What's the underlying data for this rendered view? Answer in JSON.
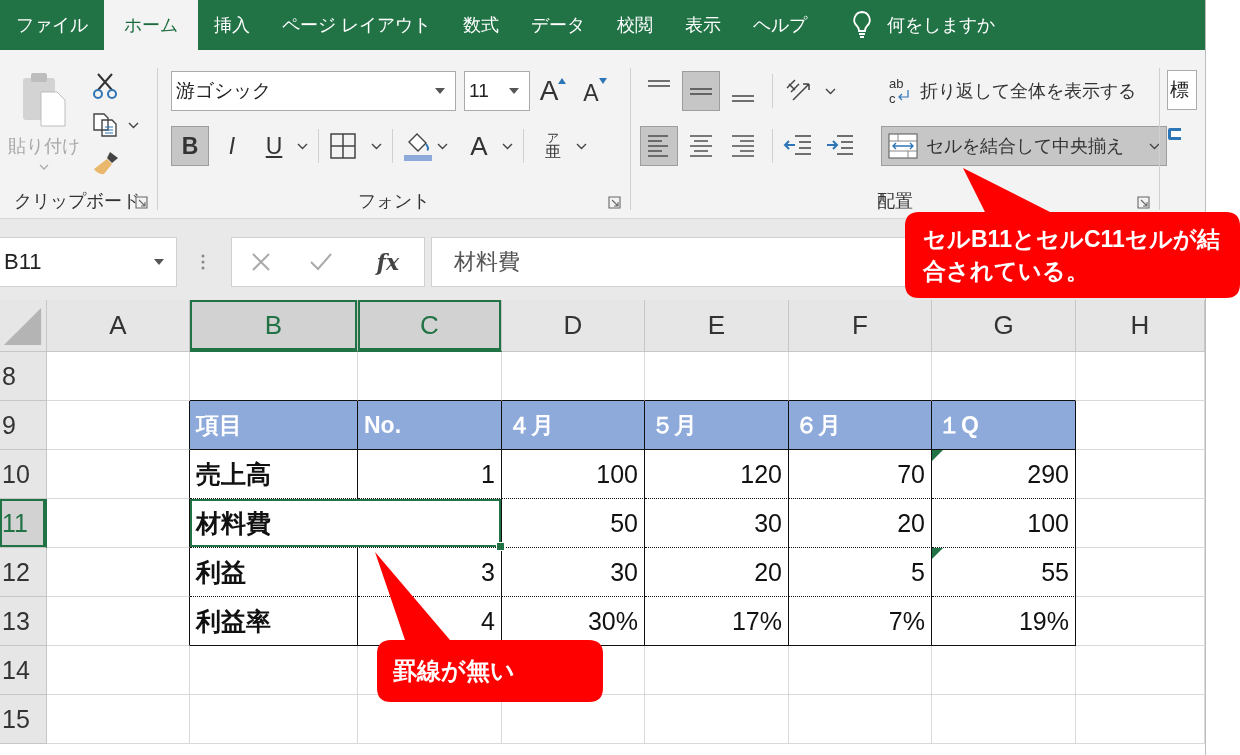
{
  "menu": {
    "tabs": [
      {
        "label": "ファイル",
        "selected": false
      },
      {
        "label": "ホーム",
        "selected": true
      },
      {
        "label": "挿入",
        "selected": false
      },
      {
        "label": "ページ レイアウト",
        "selected": false
      },
      {
        "label": "数式",
        "selected": false
      },
      {
        "label": "データ",
        "selected": false
      },
      {
        "label": "校閲",
        "selected": false
      },
      {
        "label": "表示",
        "selected": false
      },
      {
        "label": "ヘルプ",
        "selected": false
      }
    ],
    "tell_me": "何をしますか"
  },
  "ribbon": {
    "clipboard": {
      "paste": "貼り付け",
      "label": "クリップボード"
    },
    "font": {
      "name": "游ゴシック",
      "size": "11",
      "grow": "A",
      "shrink": "A",
      "styles": [
        {
          "kind": "bold",
          "label": "B",
          "pressed": true
        },
        {
          "kind": "italic",
          "label": "I",
          "pressed": false
        },
        {
          "kind": "underline",
          "label": "U",
          "pressed": false
        }
      ],
      "font_color": "A",
      "phonetic_top": "ア",
      "phonetic_bottom": "亜",
      "label": "フォント"
    },
    "alignment": {
      "vertical": [
        {
          "kind": "top",
          "pressed": false
        },
        {
          "kind": "middle",
          "pressed": true
        },
        {
          "kind": "bottom",
          "pressed": false
        }
      ],
      "horizontal": [
        {
          "kind": "left",
          "pressed": true
        },
        {
          "kind": "center",
          "pressed": false
        },
        {
          "kind": "right",
          "pressed": false
        }
      ],
      "wrap_glyph_top": "ab",
      "wrap_glyph_bottom": "c",
      "wrap_text": "折り返して全体を表示する",
      "merge": {
        "label": "セルを結合して中央揃え",
        "pressed": true
      },
      "label": "配置"
    },
    "styles": {
      "box": "標"
    }
  },
  "formula_bar": {
    "name_box": "B11",
    "fx": "fx",
    "value": "材料費"
  },
  "sheet": {
    "columns": [
      {
        "label": "A",
        "selected": false
      },
      {
        "label": "B",
        "selected": true
      },
      {
        "label": "C",
        "selected": true
      },
      {
        "label": "D",
        "selected": false
      },
      {
        "label": "E",
        "selected": false
      },
      {
        "label": "F",
        "selected": false
      },
      {
        "label": "G",
        "selected": false
      },
      {
        "label": "H",
        "selected": false
      }
    ],
    "rows": [
      {
        "label": "8",
        "selected": false,
        "kind": "empty"
      },
      {
        "label": "9",
        "selected": false,
        "kind": "header",
        "cells": [
          {
            "text": "項目",
            "merged": false,
            "selected": false,
            "error_indicator": false
          },
          {
            "text": "No.",
            "merged": false,
            "selected": false,
            "error_indicator": false
          },
          {
            "text": "４月",
            "merged": false,
            "selected": false,
            "error_indicator": false
          },
          {
            "text": "５月",
            "merged": false,
            "selected": false,
            "error_indicator": false
          },
          {
            "text": "６月",
            "merged": false,
            "selected": false,
            "error_indicator": false
          },
          {
            "text": "１Q",
            "merged": false,
            "selected": false,
            "error_indicator": false
          }
        ]
      },
      {
        "label": "10",
        "selected": false,
        "kind": "data",
        "cells": [
          {
            "text": "売上高",
            "merged": false,
            "selected": false,
            "error_indicator": false
          },
          {
            "text": "1",
            "merged": false,
            "selected": false,
            "error_indicator": false
          },
          {
            "text": "100",
            "merged": false,
            "selected": false,
            "error_indicator": false
          },
          {
            "text": "120",
            "merged": false,
            "selected": false,
            "error_indicator": false
          },
          {
            "text": "70",
            "merged": false,
            "selected": false,
            "error_indicator": false
          },
          {
            "text": "290",
            "merged": false,
            "selected": false,
            "error_indicator": true
          }
        ]
      },
      {
        "label": "11",
        "selected": true,
        "kind": "data",
        "cells": [
          {
            "text": "材料費",
            "merged": true,
            "selected": true,
            "error_indicator": false
          },
          {
            "text": "50",
            "merged": false,
            "selected": false,
            "error_indicator": false
          },
          {
            "text": "30",
            "merged": false,
            "selected": false,
            "error_indicator": false
          },
          {
            "text": "20",
            "merged": false,
            "selected": false,
            "error_indicator": false
          },
          {
            "text": "100",
            "merged": false,
            "selected": false,
            "error_indicator": false
          }
        ]
      },
      {
        "label": "12",
        "selected": false,
        "kind": "data",
        "cells": [
          {
            "text": "利益",
            "merged": false,
            "selected": false,
            "error_indicator": false
          },
          {
            "text": "3",
            "merged": false,
            "selected": false,
            "error_indicator": false
          },
          {
            "text": "30",
            "merged": false,
            "selected": false,
            "error_indicator": false
          },
          {
            "text": "20",
            "merged": false,
            "selected": false,
            "error_indicator": false
          },
          {
            "text": "5",
            "merged": false,
            "selected": false,
            "error_indicator": false
          },
          {
            "text": "55",
            "merged": false,
            "selected": false,
            "error_indicator": true
          }
        ]
      },
      {
        "label": "13",
        "selected": false,
        "kind": "data",
        "cells": [
          {
            "text": "利益率",
            "merged": false,
            "selected": false,
            "error_indicator": false
          },
          {
            "text": "4",
            "merged": false,
            "selected": false,
            "error_indicator": false
          },
          {
            "text": "30%",
            "merged": false,
            "selected": false,
            "error_indicator": false
          },
          {
            "text": "17%",
            "merged": false,
            "selected": false,
            "error_indicator": false
          },
          {
            "text": "7%",
            "merged": false,
            "selected": false,
            "error_indicator": false
          },
          {
            "text": "19%",
            "merged": false,
            "selected": false,
            "error_indicator": false
          }
        ]
      },
      {
        "label": "14",
        "selected": false,
        "kind": "empty"
      },
      {
        "label": "15",
        "selected": false,
        "kind": "empty"
      }
    ]
  },
  "callouts": [
    {
      "text": "セルB11とセルC11セルが結合されている。"
    },
    {
      "text": "罫線が無い"
    }
  ]
}
